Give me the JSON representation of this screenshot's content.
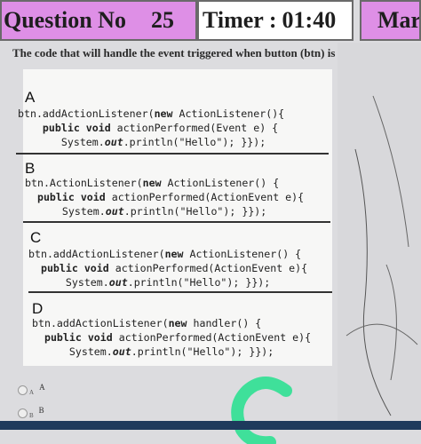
{
  "header": {
    "question_label": "Question No",
    "question_number": "25",
    "timer_label": "Timer :",
    "timer_value": "01:40",
    "marks_label": "Mark"
  },
  "question": {
    "text": "The code that will handle the event triggered when button (btn) is clicked"
  },
  "options": [
    {
      "letter": "A",
      "line1_a": "btn.addActionListener(",
      "line1_kw": "new",
      "line1_b": " ActionListener(){",
      "line2_kw": "public void",
      "line2_b": " actionPerformed(Event e) {",
      "line3_a": "System.",
      "line3_it": "out",
      "line3_b": ".println(\"Hello\"); }});"
    },
    {
      "letter": "B",
      "line1_a": "btn.ActionListener(",
      "line1_kw": "new",
      "line1_b": " ActionListener() {",
      "line2_kw": "public void",
      "line2_b": " actionPerformed(ActionEvent e){",
      "line3_a": "System.",
      "line3_it": "out",
      "line3_b": ".println(\"Hello\"); }});"
    },
    {
      "letter": "C",
      "line1_a": "btn.addActionListener(",
      "line1_kw": "new",
      "line1_b": " ActionListener() {",
      "line2_kw": "public void",
      "line2_b": " actionPerformed(ActionEvent e){",
      "line3_a": "System.",
      "line3_it": "out",
      "line3_b": ".println(\"Hello\"); }});"
    },
    {
      "letter": "D",
      "line1_a": "btn.addActionListener(",
      "line1_kw": "new",
      "line1_b": " handler() {",
      "line2_kw": "public void",
      "line2_b": " actionPerformed(ActionEvent e){",
      "line3_a": "System.",
      "line3_it": "out",
      "line3_b": ".println(\"Hello\"); }});"
    }
  ],
  "answers": [
    {
      "sub": "A",
      "label": "A"
    },
    {
      "sub": "B",
      "label": "B"
    }
  ],
  "overlay_mark": "C",
  "colors": {
    "header_pink": "#de8fe6",
    "timer_bg": "#ffffff",
    "panel_bg": "#f7f7f6",
    "overlay_green": "#3fe09a",
    "taskbar": "#1e3a5c"
  }
}
